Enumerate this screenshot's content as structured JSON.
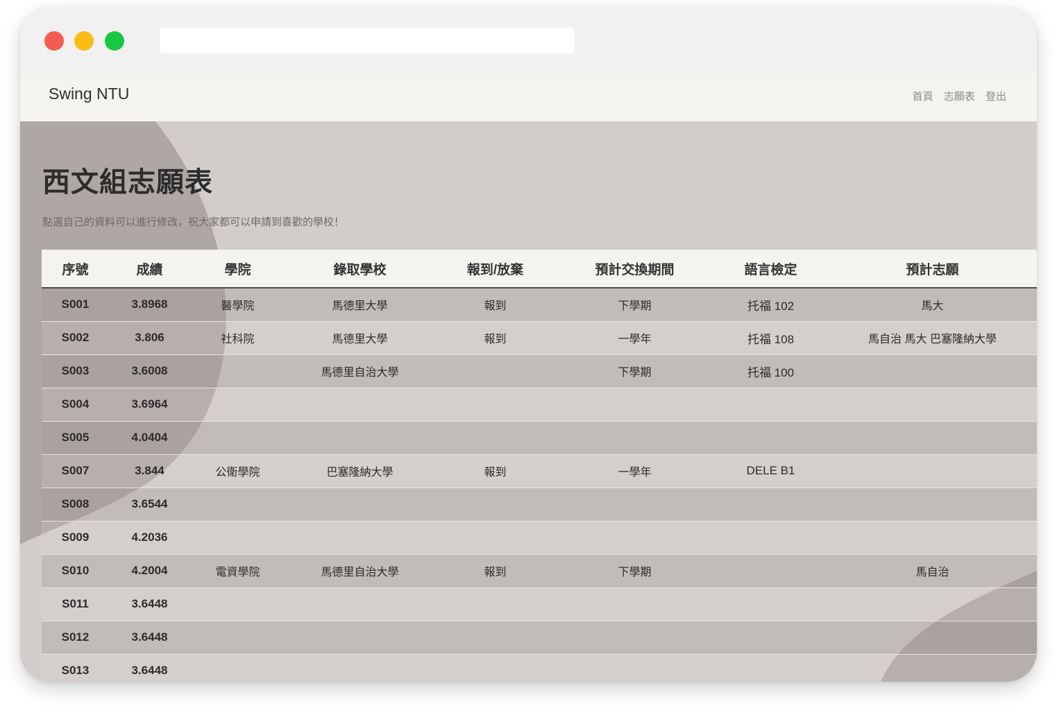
{
  "browser": {
    "url": ""
  },
  "navbar": {
    "brand": "Swing NTU",
    "links": [
      "首頁",
      "志願表",
      "登出"
    ]
  },
  "page": {
    "title": "西文組志願表",
    "subtitle": "點選自己的資料可以進行修改，祝大家都可以申請到喜歡的學校！"
  },
  "table": {
    "headers": [
      "序號",
      "成績",
      "學院",
      "錄取學校",
      "報到/放棄",
      "預計交換期間",
      "語言檢定",
      "預計志願"
    ],
    "rows": [
      [
        "S001",
        "3.8968",
        "醫學院",
        "馬德里大學",
        "報到",
        "下學期",
        "托福 102",
        "馬大"
      ],
      [
        "S002",
        "3.806",
        "社科院",
        "馬德里大學",
        "報到",
        "一學年",
        "托福 108",
        "馬自治 馬大 巴塞隆納大學"
      ],
      [
        "S003",
        "3.6008",
        "",
        "馬德里自治大學",
        "",
        "下學期",
        "托福 100",
        ""
      ],
      [
        "S004",
        "3.6964",
        "",
        "",
        "",
        "",
        "",
        ""
      ],
      [
        "S005",
        "4.0404",
        "",
        "",
        "",
        "",
        "",
        ""
      ],
      [
        "S007",
        "3.844",
        "公衛學院",
        "巴塞隆納大學",
        "報到",
        "一學年",
        "DELE B1",
        ""
      ],
      [
        "S008",
        "3.6544",
        "",
        "",
        "",
        "",
        "",
        ""
      ],
      [
        "S009",
        "4.2036",
        "",
        "",
        "",
        "",
        "",
        ""
      ],
      [
        "S010",
        "4.2004",
        "電資學院",
        "馬德里自治大學",
        "報到",
        "下學期",
        "",
        "馬自治"
      ],
      [
        "S011",
        "3.6448",
        "",
        "",
        "",
        "",
        "",
        ""
      ],
      [
        "S012",
        "3.6448",
        "",
        "",
        "",
        "",
        "",
        ""
      ],
      [
        "S013",
        "3.6448",
        "",
        "",
        "",
        "",
        "",
        ""
      ]
    ]
  },
  "colors": {
    "background": "#d2cdcb",
    "shape": "#a8a09c",
    "navbar": "#f4f3ef",
    "titlebar": "#f1f1f1"
  }
}
